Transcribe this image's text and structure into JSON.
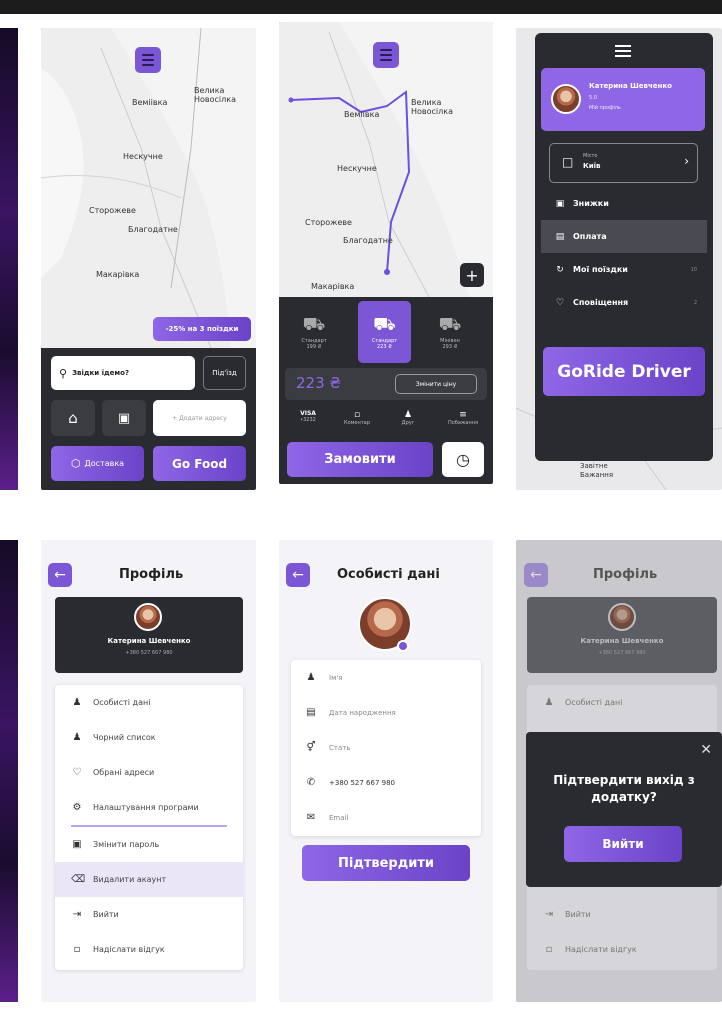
{
  "s1": {
    "towns": [
      "Веміівка",
      "Велика\nНовосілка",
      "Нескучне",
      "Сторожеве",
      "Благодатне",
      "Макарівка"
    ],
    "discount": "-25% на 3 поїздки",
    "search_placeholder": "Звідки їдемо?",
    "entrance": "Під'їзд",
    "add_address": "+ Додати адресу",
    "delivery": "Доставка",
    "go_food": "Go Food"
  },
  "s2": {
    "towns": [
      "Веміівка",
      "Велика\nНовосілка",
      "Нескучне",
      "Сторожеве",
      "Благодатне",
      "Макарівка"
    ],
    "classes": [
      {
        "name": "Стандарт",
        "price": "199 ₴"
      },
      {
        "name": "Стандарт",
        "price": "223 ₴"
      },
      {
        "name": "Мінівен",
        "price": "293 ₴"
      }
    ],
    "price": "223 ₴",
    "change_price": "Змінити ціну",
    "options": [
      {
        "label": "VISA",
        "sub": "•3232"
      },
      {
        "label": "Коментар",
        "sub": ""
      },
      {
        "label": "Друг",
        "sub": ""
      },
      {
        "label": "Побажання",
        "sub": ""
      }
    ],
    "order": "Замовити"
  },
  "s3": {
    "user_name": "Катерина Шевченко",
    "user_sub": "5.0",
    "user_profile": "Мій профіль",
    "city_label": "Місто",
    "city": "Київ",
    "menu": [
      "Знижки",
      "Оплата",
      "Мої поїздки",
      "Сповіщення"
    ],
    "badge_trips": "10",
    "badge_notif": "2",
    "brand": "GoRide Driver",
    "map_town": "Завітне\nБажання"
  },
  "s4": {
    "title": "Профіль",
    "user_name": "Катерина Шевченко",
    "phone": "+380 527 667 980",
    "items": [
      "Особисті дані",
      "Чорний список",
      "Обрані адреси",
      "Налаштування програми",
      "Змінити пароль",
      "Видалити акаунт",
      "Вийти",
      "Надіслати відгук"
    ]
  },
  "s5": {
    "title": "Особисті дані",
    "fields": [
      "Ім'я",
      "Дата народження",
      "Стать",
      "+380 527 667 980",
      "Email"
    ],
    "confirm": "Підтвердити"
  },
  "s6": {
    "title": "Профіль",
    "user_name": "Катерина Шевченко",
    "phone": "+380 527 667 980",
    "item_top": "Особисті дані",
    "dialog_question": "Підтвердити вихід з додатку?",
    "exit_btn": "Вийти",
    "item_exit": "Вийти",
    "item_feedback": "Надіслати відгук"
  }
}
